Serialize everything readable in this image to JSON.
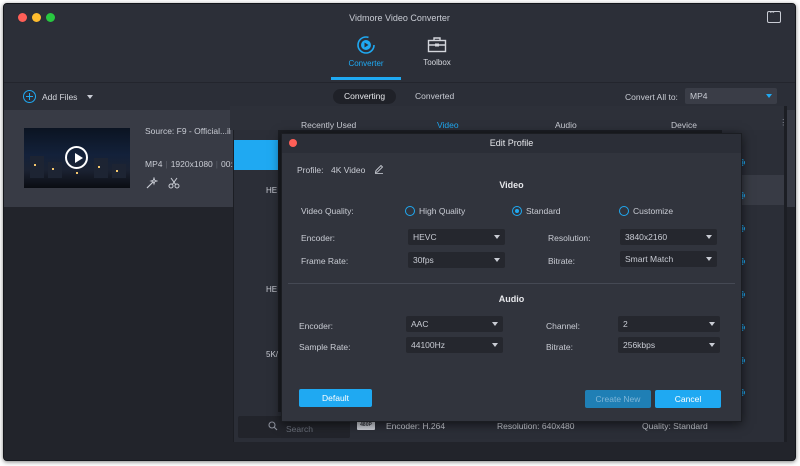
{
  "app": {
    "title": "Vidmore Video Converter"
  },
  "nav": {
    "converter": "Converter",
    "toolbox": "Toolbox"
  },
  "toolbar": {
    "add_files": "Add Files",
    "tab_converting": "Converting",
    "tab_converted": "Converted",
    "convert_all_label": "Convert All to:",
    "convert_all_value": "MP4"
  },
  "file": {
    "source": "Source: F9 - Official...il",
    "format": "MP4",
    "resolution": "1920x1080",
    "duration": "00:0"
  },
  "format_tabs": {
    "recent": "Recently Used",
    "video": "Video",
    "audio": "Audio",
    "device": "Device"
  },
  "side_labels": [
    "HE",
    "HE",
    "5K/"
  ],
  "bottom_row": {
    "search_placeholder": "Search",
    "badge": "480P",
    "encoder": "Encoder: H.264",
    "resolution": "Resolution: 640x480",
    "quality": "Quality: Standard"
  },
  "dialog": {
    "title": "Edit Profile",
    "profile_label": "Profile:",
    "profile_value": "4K Video",
    "video_section": "Video",
    "video_quality_label": "Video Quality:",
    "quality_options": [
      "High Quality",
      "Standard",
      "Customize"
    ],
    "quality_selected": "Standard",
    "encoder_label": "Encoder:",
    "encoder_value": "HEVC",
    "resolution_label": "Resolution:",
    "resolution_value": "3840x2160",
    "frame_rate_label": "Frame Rate:",
    "frame_rate_value": "30fps",
    "bitrate_label": "Bitrate:",
    "bitrate_value": "Smart Match",
    "audio_section": "Audio",
    "audio_encoder_label": "Encoder:",
    "audio_encoder_value": "AAC",
    "channel_label": "Channel:",
    "channel_value": "2",
    "sample_rate_label": "Sample Rate:",
    "sample_rate_value": "44100Hz",
    "audio_bitrate_label": "Bitrate:",
    "audio_bitrate_value": "256kbps",
    "default_button": "Default",
    "create_new_button": "Create New",
    "cancel_button": "Cancel"
  },
  "colors": {
    "accent": "#1fa9f2",
    "background": "#2b2e37",
    "close": "#ff5f57"
  }
}
